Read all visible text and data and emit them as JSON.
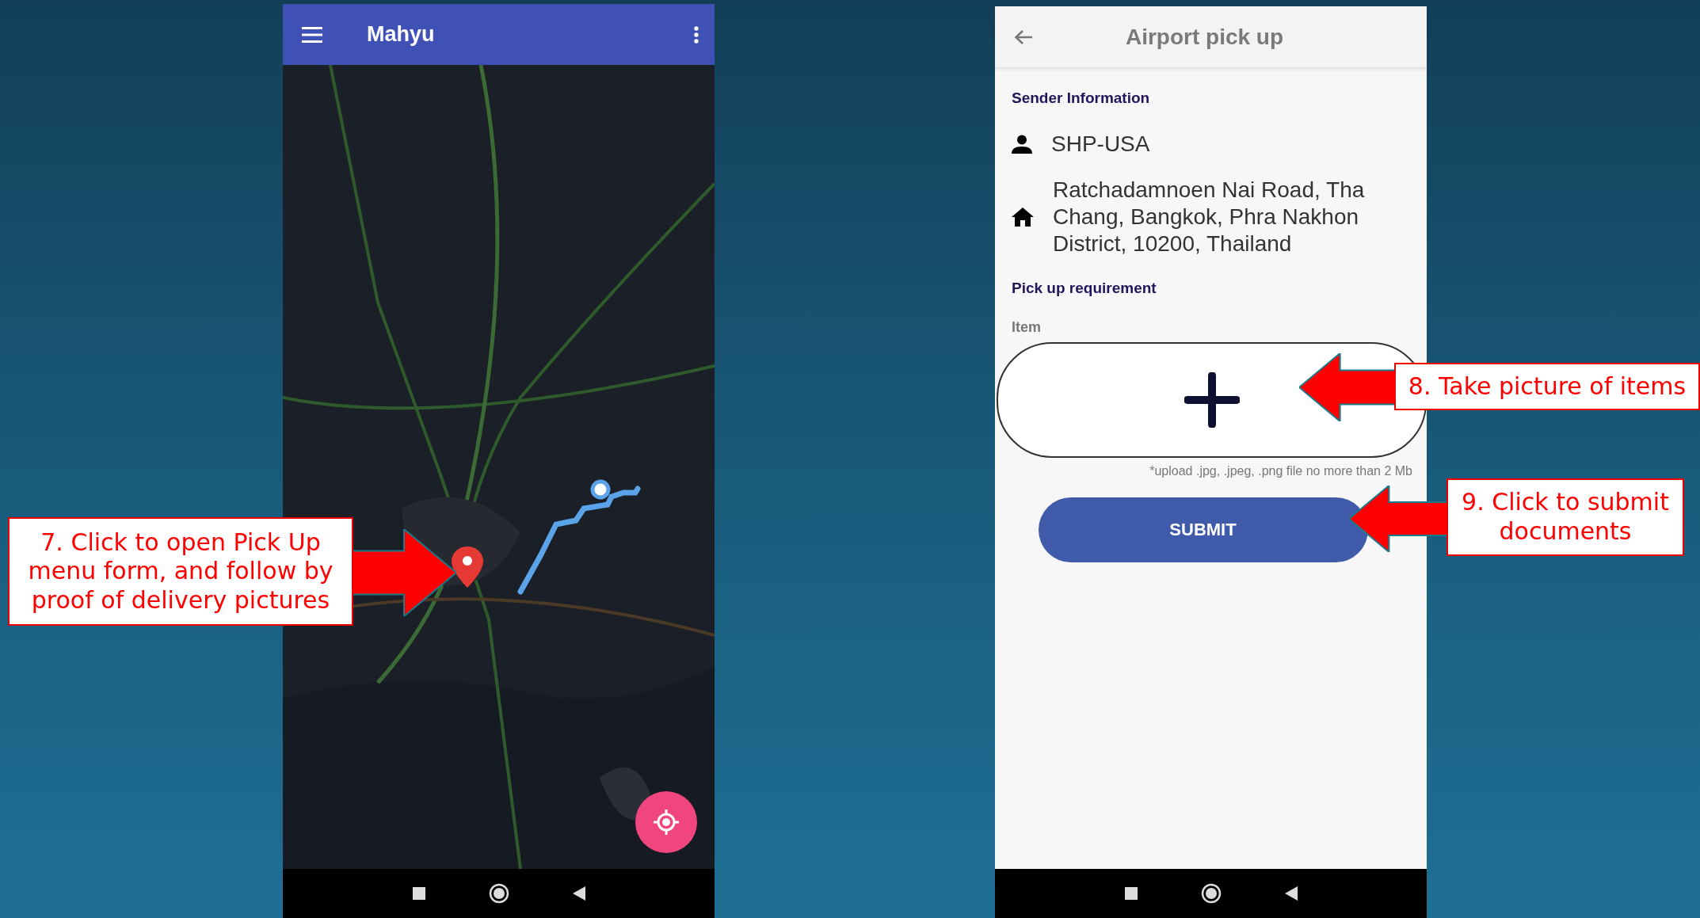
{
  "map_app": {
    "title": "Mahyu"
  },
  "pickup_form": {
    "title": "Airport pick up",
    "sender_heading": "Sender Information",
    "sender_name": "SHP-USA",
    "sender_address": "Ratchadamnoen Nai Road, Tha Chang, Bangkok, Phra Nakhon District, 10200, Thailand",
    "requirement_heading": "Pick up requirement",
    "item_label": "Item",
    "upload_note": "*upload .jpg, .jpeg, .png file no more than 2 Mb",
    "submit_label": "SUBMIT"
  },
  "annotations": [
    {
      "text": "7. Click to open Pick Up menu form, and follow by proof of delivery pictures",
      "kind": "rightward"
    },
    {
      "text": "8. Take picture of items",
      "kind": "leftward"
    },
    {
      "text": "9. Click to submit documents",
      "kind": "leftward"
    }
  ]
}
